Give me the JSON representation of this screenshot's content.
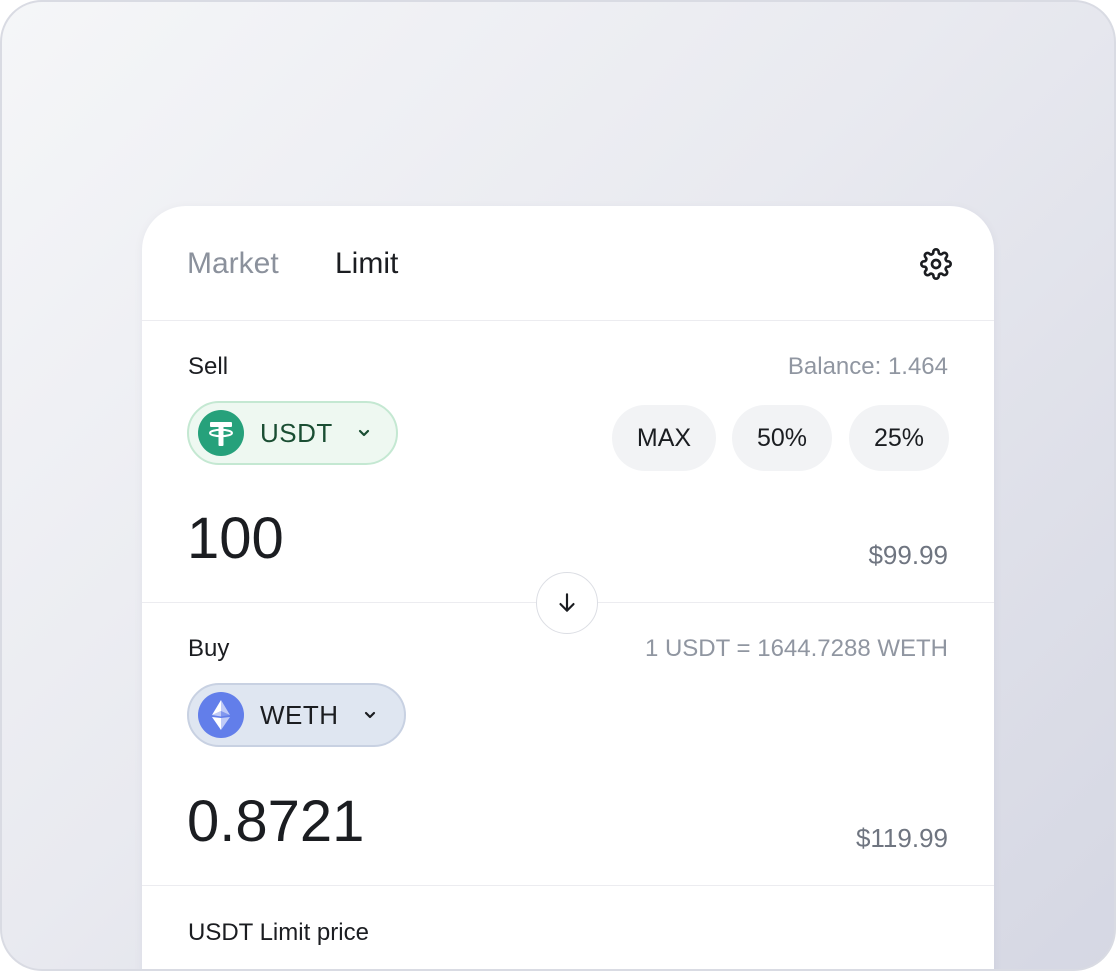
{
  "tabs": [
    {
      "label": "Market",
      "active": false
    },
    {
      "label": "Limit",
      "active": true
    }
  ],
  "header": {
    "settings_icon": "gear-icon"
  },
  "sell": {
    "label": "Sell",
    "balance": "Balance: 1.464",
    "token": {
      "symbol": "USDT",
      "icon": "tether-icon"
    },
    "presets": [
      "MAX",
      "50%",
      "25%"
    ],
    "amount": "100",
    "usd_value": "$99.99"
  },
  "swap": {
    "icon": "arrow-down-icon"
  },
  "buy": {
    "label": "Buy",
    "rate": "1 USDT = 1644.7288 WETH",
    "token": {
      "symbol": "WETH",
      "icon": "ethereum-icon"
    },
    "amount": "0.8721",
    "usd_value": "$119.99"
  },
  "limit": {
    "label": "USDT Limit price"
  },
  "colors": {
    "accent_green": "#26a17b",
    "eth_purple": "#627eea",
    "text_primary": "#1b1d21",
    "text_muted": "#9096a1"
  }
}
